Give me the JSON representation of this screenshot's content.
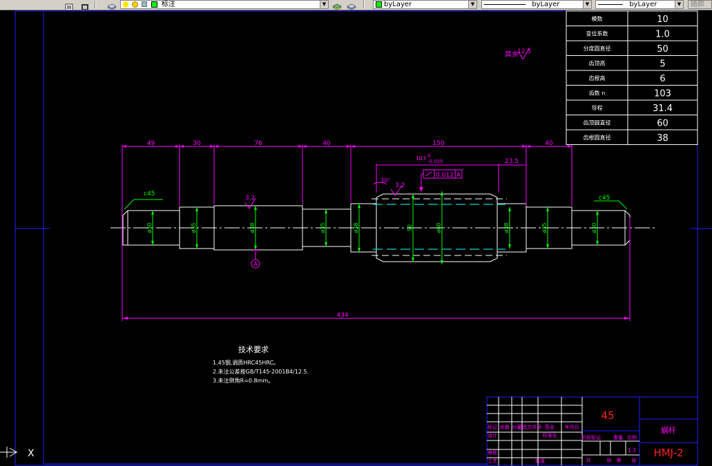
{
  "toolbar": {
    "layer_value": "标注",
    "color_value": "byLayer",
    "linetype_value": "byLayer",
    "lineweight_value": "byLayer",
    "plotstyle_value": "随颜",
    "icons": [
      "layers-manager-icon",
      "lightbulb-icon",
      "sun-icon",
      "lock-icon",
      "color-square-icon",
      "layer-previous-icon",
      "layer-stack-icon"
    ]
  },
  "colors": {
    "background": "#000000",
    "frame": "#2222ff",
    "dimension": "#ff00ff",
    "centerline": "#ffffff",
    "hidden": "#00d8d8",
    "extent": "#00ff00",
    "table_border": "#ffffff",
    "title_red": "#ff2020",
    "accent_magenta": "#ff00ff"
  },
  "param_table": {
    "rows": [
      {
        "label": "模数",
        "value": "10"
      },
      {
        "label": "变位系数",
        "value": "1.0"
      },
      {
        "label": "分度圆直径",
        "value": "50"
      },
      {
        "label": "齿顶高",
        "value": "5"
      },
      {
        "label": "齿根高",
        "value": "6"
      },
      {
        "label": "齿数 n",
        "value": "103"
      },
      {
        "label": "导程",
        "value": "31.4"
      },
      {
        "label": "齿顶圆直径",
        "value": "60"
      },
      {
        "label": "齿根圆直径",
        "value": "38"
      }
    ]
  },
  "roughness_note": {
    "prefix": "其余",
    "value": "12.5"
  },
  "dimensions": {
    "top_segments": [
      "49",
      "30",
      "76",
      "40",
      "150",
      "40"
    ],
    "sub_dim_left": "103",
    "sub_dim_tol_upper": "0",
    "sub_dim_tol_lower": "-0.035",
    "sub_dim_right": "23.5",
    "geo_tol_value": "0.012",
    "geo_tol_datum": "A",
    "angle_label": "30°",
    "roughness_1": "3.2",
    "roughness_2": "3.2",
    "chamfer_left": "c45",
    "chamfer_right": "c45",
    "diameters": [
      "ø30",
      "ø35",
      "ø38",
      "ø35",
      "ø38",
      "50",
      "ø60",
      "ø38",
      "ø35",
      "ø30"
    ],
    "datum_label": "A",
    "overall": "434"
  },
  "tech_req": {
    "title": "技术要求",
    "lines": [
      "1.45钢,调质HRC45HRC。",
      "2.未注公差按GB/T145-2001B4/12.5.",
      "3.未注倒角R=0.8mm。"
    ]
  },
  "title_block": {
    "material": "45",
    "part_name": "蜗杆",
    "drawing_no": "HMJ-2",
    "scale_value": "1:1",
    "headers_row1": [
      "标记",
      "处数",
      "分区",
      "更改文件号",
      "签名",
      "年月日"
    ],
    "headers_row2": [
      "设计",
      "",
      "标准化",
      ""
    ],
    "headers_row3": [
      "审核",
      "",
      ""
    ],
    "headers_row4": [
      "工艺",
      "",
      "批准",
      ""
    ],
    "stage_labels": [
      "阶段标记",
      "重量",
      "比例"
    ],
    "sheet_labels": [
      "共",
      "张",
      "第",
      "张"
    ]
  },
  "ucs_label": "X"
}
